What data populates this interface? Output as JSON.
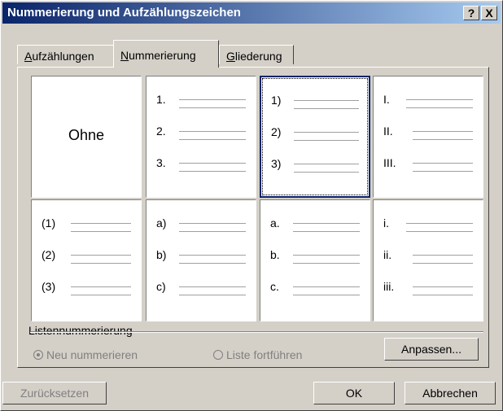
{
  "dialog": {
    "title": "Nummerierung und Aufzählungszeichen",
    "help_button": "?",
    "close_button": "X"
  },
  "tabs": [
    {
      "label": "Aufzählungen",
      "accel": "A",
      "rest": "ufzählungen",
      "active": false
    },
    {
      "label": "Nummerierung",
      "accel": "N",
      "rest": "ummerierung",
      "active": true
    },
    {
      "label": "Gliederung",
      "accel": "G",
      "rest": "liederung",
      "active": false
    }
  ],
  "styles": [
    {
      "name": "none",
      "caption": "Ohne",
      "markers": []
    },
    {
      "name": "arabic-period",
      "markers": [
        "1.",
        "2.",
        "3."
      ]
    },
    {
      "name": "arabic-paren",
      "markers": [
        "1)",
        "2)",
        "3)"
      ],
      "selected": true
    },
    {
      "name": "roman-upper",
      "markers": [
        "I.",
        "II.",
        "III."
      ]
    },
    {
      "name": "arabic-both-paren",
      "markers": [
        "(1)",
        "(2)",
        "(3)"
      ]
    },
    {
      "name": "alpha-paren",
      "markers": [
        "a)",
        "b)",
        "c)"
      ]
    },
    {
      "name": "alpha-period",
      "markers": [
        "a.",
        "b.",
        "c."
      ]
    },
    {
      "name": "roman-lower",
      "markers": [
        "i.",
        "ii.",
        "iii."
      ]
    }
  ],
  "list_numbering": {
    "label": "Listennummerierung",
    "restart_label": "Neu nummerieren",
    "continue_label": "Liste fortführen",
    "restart_selected": true,
    "enabled": false
  },
  "buttons": {
    "customize": "Anpassen...",
    "customize_accel": "p",
    "reset": "Zurücksetzen",
    "ok": "OK",
    "cancel": "Abbrechen"
  },
  "colors": {
    "face": "#d4d0c8",
    "title_start": "#0a246a",
    "title_end": "#a6caf0",
    "selection": "#0a246a"
  }
}
